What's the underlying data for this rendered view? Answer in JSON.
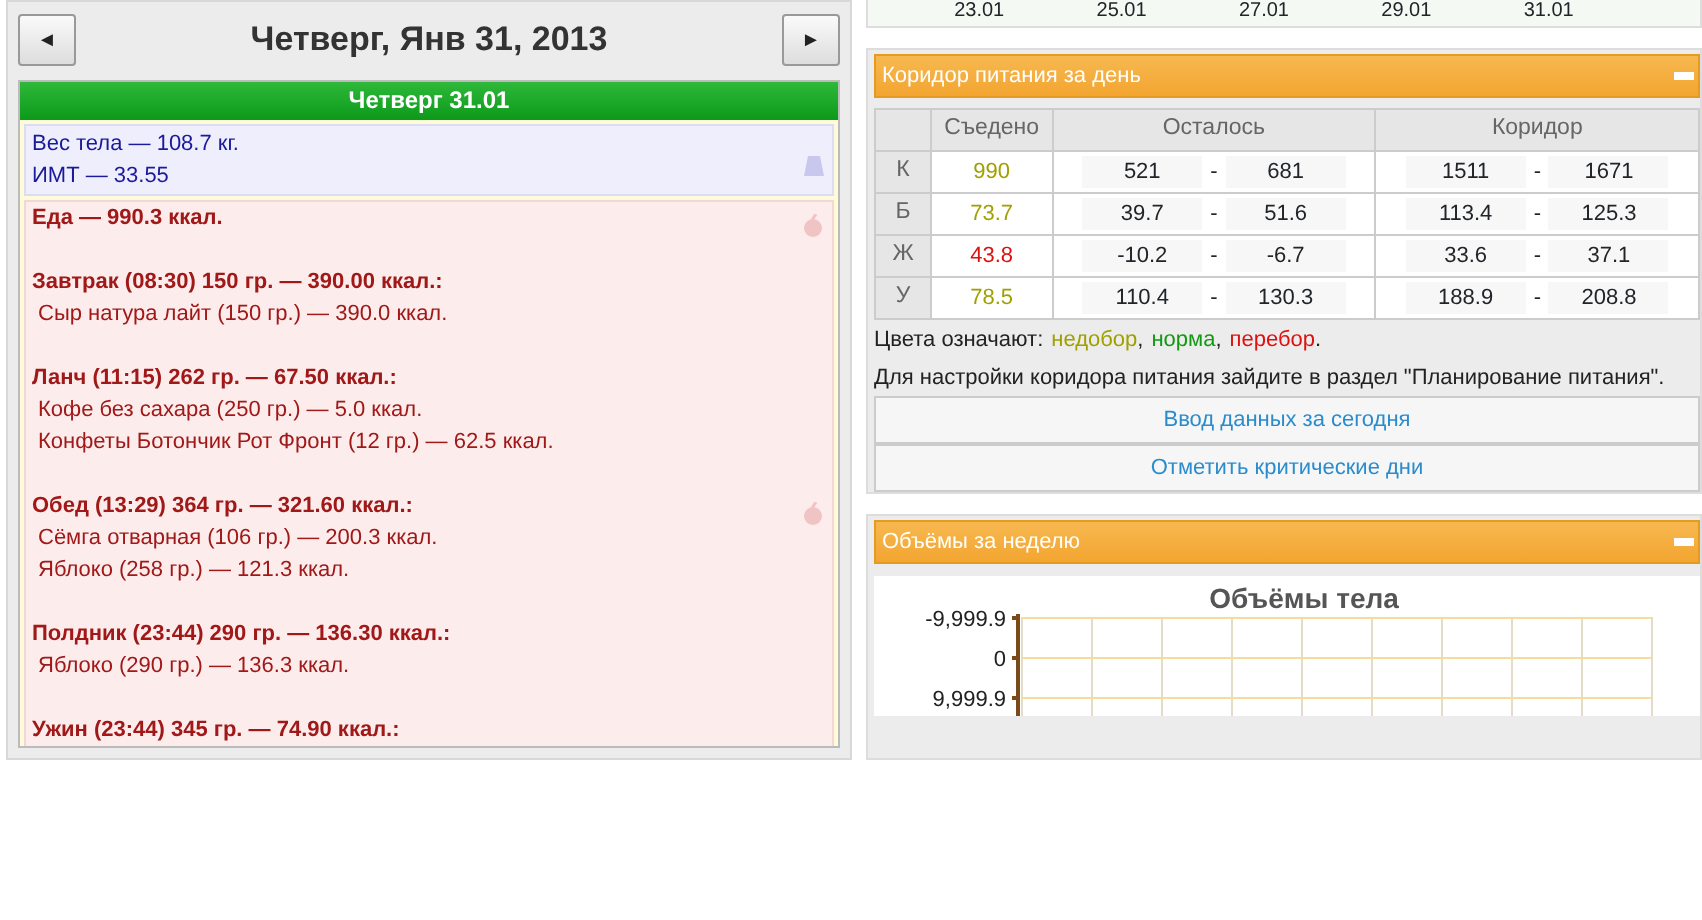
{
  "day_nav": {
    "title": "Четверг, Янв 31, 2013",
    "prev_button": "◄",
    "next_button": "►"
  },
  "day_panel": {
    "header": "Четверг 31.01",
    "body": {
      "lines": [
        "Вес тела — 108.7 кг.",
        "ИМТ — 33.55"
      ]
    },
    "food": {
      "total": "Еда — 990.3 ккал.",
      "meals": [
        {
          "title": "Завтрак (08:30) 150 гр. — 390.00 ккал.:",
          "items": [
            "Сыр натура лайт (150 гр.) — 390.0 ккал."
          ]
        },
        {
          "title": "Ланч (11:15) 262 гр. — 67.50 ккал.:",
          "items": [
            "Кофе без сахара (250 гр.) — 5.0 ккал.",
            "Конфеты Ботончик Рот Фронт (12 гр.) — 62.5 ккал."
          ]
        },
        {
          "title": "Обед (13:29) 364 гр. — 321.60 ккал.:",
          "items": [
            "Сёмга отварная (106 гр.) — 200.3 ккал.",
            "Яблоко (258 гр.) — 121.3 ккал."
          ]
        },
        {
          "title": "Полдник (23:44) 290 гр. — 136.30 ккал.:",
          "items": [
            "Яблоко (290 гр.) — 136.3 ккал."
          ]
        },
        {
          "title": "Ужин (23:44) 345 гр. — 74.90 ккал.:"
        }
      ]
    }
  },
  "top_chart": {
    "x_labels": [
      "23.01",
      "25.01",
      "27.01",
      "29.01",
      "31.01"
    ]
  },
  "corridor": {
    "title": "Коридор питания за день",
    "columns": [
      "Съедено",
      "Осталось",
      "Коридор"
    ],
    "rows": [
      {
        "label": "К",
        "eaten": "990",
        "color": "#a0a000",
        "left_min": "521",
        "left_max": "681",
        "corr_min": "1511",
        "corr_max": "1671"
      },
      {
        "label": "Б",
        "eaten": "73.7",
        "color": "#a0a000",
        "left_min": "39.7",
        "left_max": "51.6",
        "corr_min": "113.4",
        "corr_max": "125.3"
      },
      {
        "label": "Ж",
        "eaten": "43.8",
        "color": "#dd1111",
        "left_min": "-10.2",
        "left_max": "-6.7",
        "corr_min": "33.6",
        "corr_max": "37.1"
      },
      {
        "label": "У",
        "eaten": "78.5",
        "color": "#a0a000",
        "left_min": "110.4",
        "left_max": "130.3",
        "corr_min": "188.9",
        "corr_max": "208.8"
      }
    ],
    "separator": "-",
    "legend": {
      "label": "Цвета означают:",
      "items": [
        {
          "text": "недобор",
          "color": "#a0a000",
          "punctuation": ","
        },
        {
          "text": "норма",
          "color": "#119911",
          "punctuation": ","
        },
        {
          "text": "перебор",
          "color": "#dd1111",
          "punctuation": "."
        }
      ]
    },
    "note": "Для настройки коридора питания зайдите в раздел \"Планирование питания\".",
    "buttons": [
      "Ввод данных за сегодня",
      "Отметить критические дни"
    ]
  },
  "volumes": {
    "title": "Объёмы за неделю",
    "chart_title": "Объёмы тела",
    "y_tick_labels": [
      "-9,999.9",
      "0",
      "9,999.9"
    ]
  }
}
